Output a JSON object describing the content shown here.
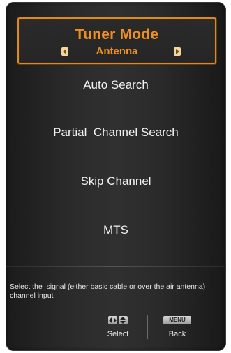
{
  "menu": {
    "selected": {
      "title": "Tuner Mode",
      "value": "Antenna"
    },
    "items": [
      {
        "label": "Auto Search"
      },
      {
        "label": "Partial  Channel Search"
      },
      {
        "label": "Skip Channel"
      },
      {
        "label": "MTS"
      }
    ]
  },
  "help": {
    "text": "Select the  signal (either basic cable or over the air antenna) channel input"
  },
  "hints": {
    "select_label": "Select",
    "menu_button": "MENU",
    "back_label": "Back"
  },
  "colors": {
    "accent": "#ef8f20",
    "background": "#2a2a2a",
    "text": "#f2f2f2"
  }
}
